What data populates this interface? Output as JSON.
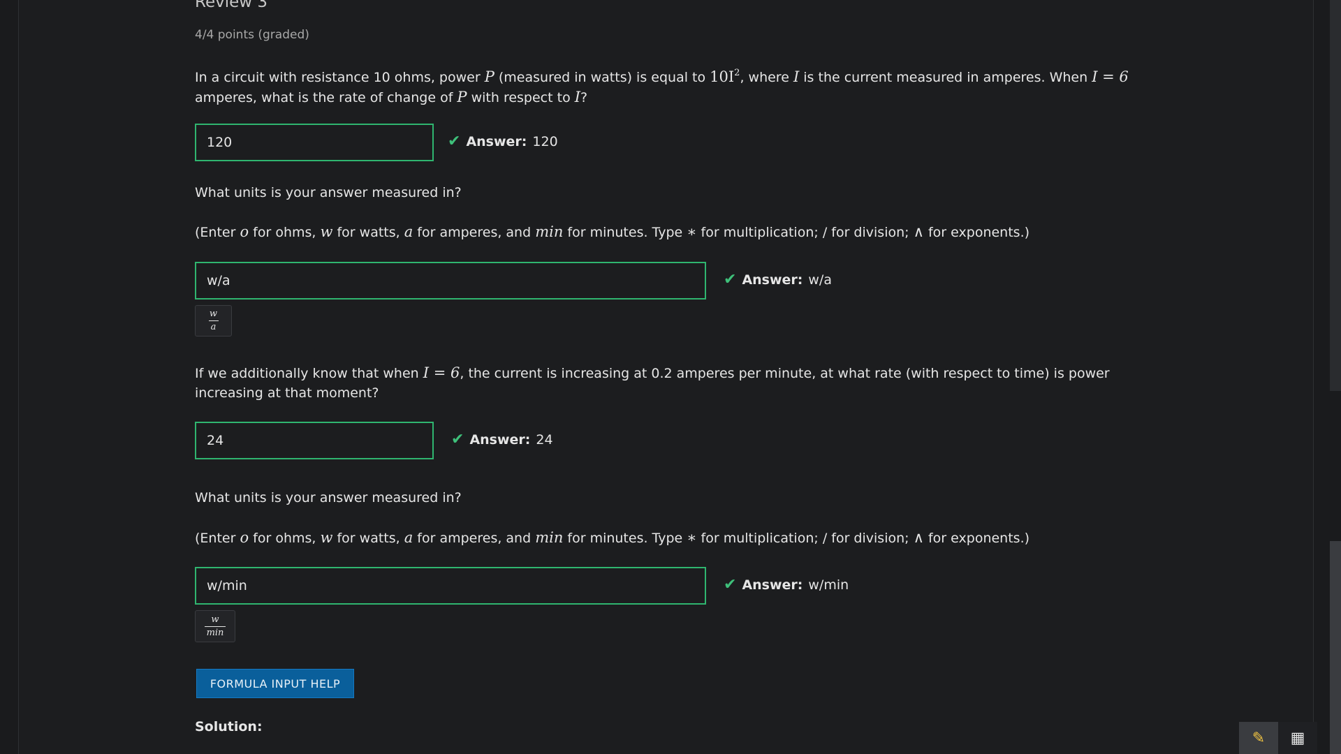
{
  "header": {
    "title": "Review 3",
    "points": "4/4 points (graded)"
  },
  "q1": {
    "text_a": "In a circuit with resistance 10 ohms, power ",
    "math_P": "P",
    "text_b": " (measured in watts) is equal to ",
    "math_10I": "10I",
    "math_exp": "2",
    "text_c": ", where ",
    "math_I": "I",
    "text_d": " is the current measured in amperes. When ",
    "math_eq": "I = 6",
    "text_e": " amperes, what is the rate of change of ",
    "math_P2": "P",
    "text_f": " with respect to ",
    "math_I2": "I",
    "text_g": "?",
    "input_value": "120",
    "answer_label": "Answer:",
    "answer_value": "120"
  },
  "q2": {
    "prompt": "What units is your answer measured in?",
    "hint_a": "(Enter ",
    "m_o": "o",
    "hint_b": " for ohms, ",
    "m_w": "w",
    "hint_c": " for watts, ",
    "m_a": "a",
    "hint_d": " for amperes, and ",
    "m_min": "min",
    "hint_e": " for minutes. Type ",
    "m_star": "∗",
    "hint_f": " for multiplication; / for division; ",
    "m_wedge": "∧",
    "hint_g": " for exponents.)",
    "input_value": "w/a",
    "answer_label": "Answer:",
    "answer_value": "w/a",
    "preview_num": "w",
    "preview_den": "a"
  },
  "q3": {
    "text_a": "If we additionally know that when ",
    "math_eq": "I = 6",
    "text_b": ", the current is increasing at 0.2 amperes per minute, at what rate (with respect to time) is power increasing at that moment?",
    "input_value": "24",
    "answer_label": "Answer:",
    "answer_value": "24"
  },
  "q4": {
    "prompt": "What units is your answer measured in?",
    "hint_a": "(Enter ",
    "m_o": "o",
    "hint_b": " for ohms, ",
    "m_w": "w",
    "hint_c": " for watts, ",
    "m_a": "a",
    "hint_d": " for amperes, and ",
    "m_min": "min",
    "hint_e": " for minutes. Type ",
    "m_star": "∗",
    "hint_f": " for multiplication; / for division; ",
    "m_wedge": "∧",
    "hint_g": " for exponents.)",
    "input_value": "w/min",
    "answer_label": "Answer:",
    "answer_value": "w/min",
    "preview_num": "w",
    "preview_den": "min"
  },
  "footer": {
    "help_button": "FORMULA INPUT HELP",
    "solution_label": "Solution:"
  },
  "icons": {
    "check": "✔",
    "pencil": "✎",
    "calculator": "▦"
  },
  "colors": {
    "success": "#2fb56f",
    "primary_button": "#0a5f9b",
    "pencil": "#f2c542"
  }
}
